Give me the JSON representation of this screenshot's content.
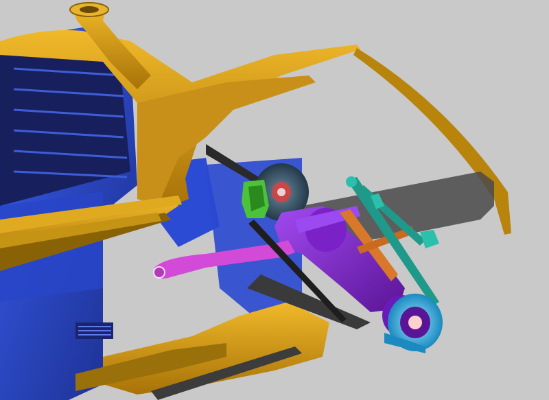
{
  "scene": {
    "kind": "3d-scan-viewport",
    "colors": {
      "background": "#c9c9c9",
      "cab_blue": "#2f4fd8",
      "cab_blue_dark": "#1a2c8a",
      "body_gold": "#d6a018",
      "body_gold_dark": "#8a6206",
      "axle_purple": "#8a2bd6",
      "arm_magenta": "#d44ad8",
      "brake_cyan": "#2ab4e0",
      "link_teal": "#1f9a8a",
      "caliper_green": "#4cc23a",
      "rod_orange": "#d9782a",
      "shaft_dark": "#2a2a2a"
    },
    "parts": [
      "cab-panel",
      "fender-body",
      "snorkel",
      "leaf-spring",
      "frame-rail",
      "brake-disc-upper",
      "brake-caliper",
      "axle-housing",
      "trailing-arm",
      "steering-link",
      "wheel-hub-lower",
      "tie-rod"
    ]
  }
}
